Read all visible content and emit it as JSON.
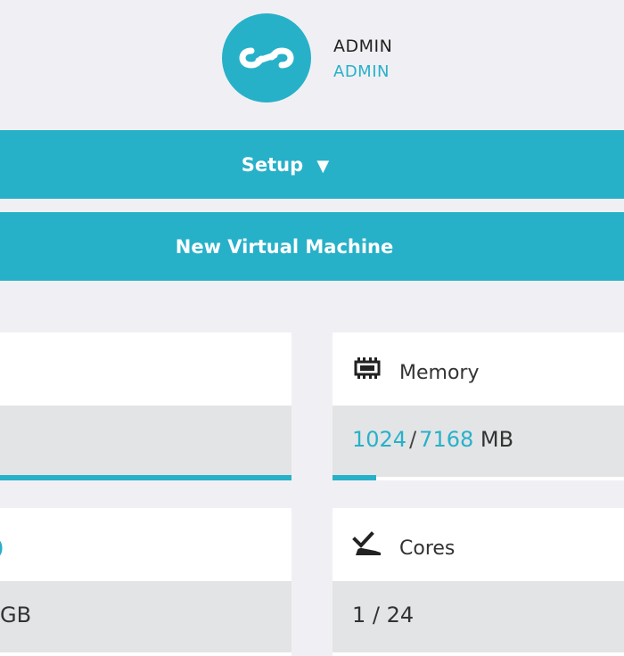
{
  "user": {
    "name": "ADMIN",
    "role": "ADMIN"
  },
  "actions": {
    "setup_label": "Setup",
    "setup_caret": "▼",
    "new_vm_label": "New Virtual Machine"
  },
  "cards": {
    "left_top": {
      "progress_percent": 100
    },
    "memory": {
      "title": "Memory",
      "used": "1024",
      "separator": "/",
      "total": "7168",
      "unit": "MB",
      "progress_percent": 14.3
    },
    "left_bottom": {
      "value_fragment": "GB"
    },
    "cores": {
      "title": "Cores",
      "value": "1 / 24"
    }
  },
  "colors": {
    "accent": "#27b1c9",
    "page_background": "#f0f0f4",
    "value_row_background": "#e3e4e6"
  },
  "icons": {
    "avatar": "infinity-link-icon",
    "memory": "memory-chip-icon",
    "cores": "cpu-cores-icon"
  }
}
